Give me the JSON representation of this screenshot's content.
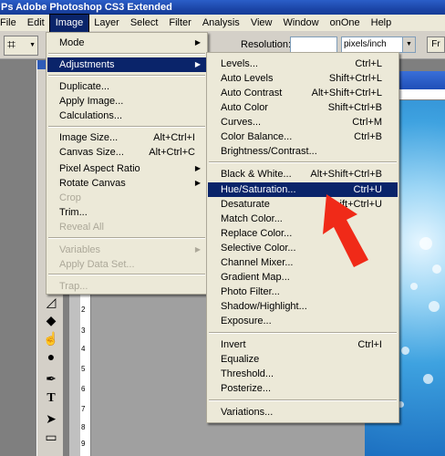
{
  "app": {
    "title": "Ps Adobe Photoshop CS3 Extended"
  },
  "menubar": [
    "File",
    "Edit",
    "Image",
    "Layer",
    "Select",
    "Filter",
    "Analysis",
    "View",
    "Window",
    "onOne",
    "Help"
  ],
  "options": {
    "resolution_label": "Resolution:",
    "resolution_value": "",
    "units": "pixels/inch",
    "front_image_label": "Fr"
  },
  "ruler": [
    "2",
    "3",
    "4",
    "5",
    "6",
    "7",
    "8",
    "9",
    "2",
    "0"
  ],
  "image_menu": {
    "items": [
      {
        "label": "Mode",
        "shortcut": "",
        "submenu": true,
        "state": "normal"
      },
      {
        "label": "Adjustments",
        "shortcut": "",
        "submenu": true,
        "state": "highlighted"
      },
      {
        "label": "Duplicate...",
        "shortcut": "",
        "submenu": false,
        "state": "normal"
      },
      {
        "label": "Apply Image...",
        "shortcut": "",
        "submenu": false,
        "state": "normal"
      },
      {
        "label": "Calculations...",
        "shortcut": "",
        "submenu": false,
        "state": "normal"
      },
      {
        "label": "Image Size...",
        "shortcut": "Alt+Ctrl+I",
        "submenu": false,
        "state": "normal"
      },
      {
        "label": "Canvas Size...",
        "shortcut": "Alt+Ctrl+C",
        "submenu": false,
        "state": "normal"
      },
      {
        "label": "Pixel Aspect Ratio",
        "shortcut": "",
        "submenu": true,
        "state": "normal"
      },
      {
        "label": "Rotate Canvas",
        "shortcut": "",
        "submenu": true,
        "state": "normal"
      },
      {
        "label": "Crop",
        "shortcut": "",
        "submenu": false,
        "state": "disabled"
      },
      {
        "label": "Trim...",
        "shortcut": "",
        "submenu": false,
        "state": "normal"
      },
      {
        "label": "Reveal All",
        "shortcut": "",
        "submenu": false,
        "state": "disabled"
      },
      {
        "label": "Variables",
        "shortcut": "",
        "submenu": true,
        "state": "disabled"
      },
      {
        "label": "Apply Data Set...",
        "shortcut": "",
        "submenu": false,
        "state": "disabled"
      },
      {
        "label": "Trap...",
        "shortcut": "",
        "submenu": false,
        "state": "disabled"
      }
    ]
  },
  "adjustments_menu": {
    "items": [
      {
        "label": "Levels...",
        "shortcut": "Ctrl+L",
        "state": "normal"
      },
      {
        "label": "Auto Levels",
        "shortcut": "Shift+Ctrl+L",
        "state": "normal"
      },
      {
        "label": "Auto Contrast",
        "shortcut": "Alt+Shift+Ctrl+L",
        "state": "normal"
      },
      {
        "label": "Auto Color",
        "shortcut": "Shift+Ctrl+B",
        "state": "normal"
      },
      {
        "label": "Curves...",
        "shortcut": "Ctrl+M",
        "state": "normal"
      },
      {
        "label": "Color Balance...",
        "shortcut": "Ctrl+B",
        "state": "normal"
      },
      {
        "label": "Brightness/Contrast...",
        "shortcut": "",
        "state": "normal"
      },
      {
        "label": "Black & White...",
        "shortcut": "Alt+Shift+Ctrl+B",
        "state": "normal"
      },
      {
        "label": "Hue/Saturation...",
        "shortcut": "Ctrl+U",
        "state": "highlighted"
      },
      {
        "label": "Desaturate",
        "shortcut": "ift+Ctrl+U",
        "state": "normal"
      },
      {
        "label": "Match Color...",
        "shortcut": "",
        "state": "normal"
      },
      {
        "label": "Replace Color...",
        "shortcut": "",
        "state": "normal"
      },
      {
        "label": "Selective Color...",
        "shortcut": "",
        "state": "normal"
      },
      {
        "label": "Channel Mixer...",
        "shortcut": "",
        "state": "normal"
      },
      {
        "label": "Gradient Map...",
        "shortcut": "",
        "state": "normal"
      },
      {
        "label": "Photo Filter...",
        "shortcut": "",
        "state": "normal"
      },
      {
        "label": "Shadow/Highlight...",
        "shortcut": "",
        "state": "normal"
      },
      {
        "label": "Exposure...",
        "shortcut": "",
        "state": "normal"
      },
      {
        "label": "Invert",
        "shortcut": "Ctrl+I",
        "state": "normal"
      },
      {
        "label": "Equalize",
        "shortcut": "",
        "state": "normal"
      },
      {
        "label": "Threshold...",
        "shortcut": "",
        "state": "normal"
      },
      {
        "label": "Posterize...",
        "shortcut": "",
        "state": "normal"
      },
      {
        "label": "Variations...",
        "shortcut": "",
        "state": "normal"
      }
    ]
  },
  "annotation": {
    "arrow_color": "#f02a18",
    "points_to": "Hue/Saturation..."
  },
  "colors": {
    "menu_bg": "#ece9d8",
    "highlight": "#0a246a",
    "disabled": "#aca899",
    "titlebar": "#1c46a8"
  },
  "tools": [
    "marquee-tool-icon",
    "paint-bucket-icon",
    "smudge-icon",
    "burn-icon",
    "pen-icon",
    "type-icon",
    "path-select-icon",
    "shape-icon"
  ]
}
